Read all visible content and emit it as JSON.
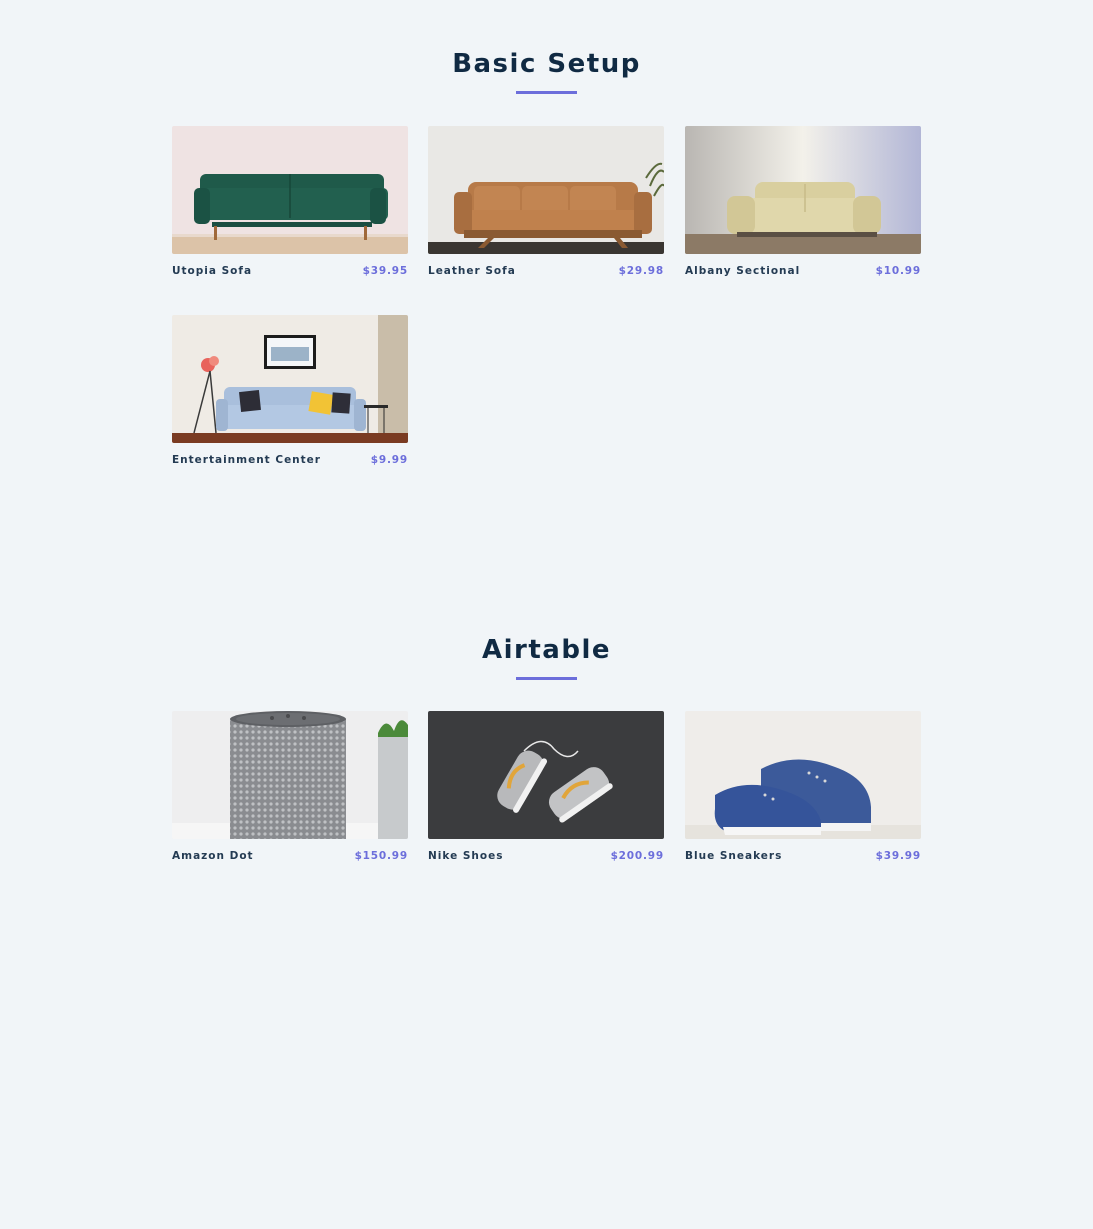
{
  "sections": [
    {
      "title": "Basic Setup",
      "products": [
        {
          "name": "Utopia Sofa",
          "price": "$39.95",
          "image": "green-sofa-image"
        },
        {
          "name": "Leather Sofa",
          "price": "$29.98",
          "image": "leather-sofa-image"
        },
        {
          "name": "Albany Sectional",
          "price": "$10.99",
          "image": "beige-sofa-image"
        },
        {
          "name": "Entertainment Center",
          "price": "$9.99",
          "image": "living-room-image"
        }
      ]
    },
    {
      "title": "Airtable",
      "products": [
        {
          "name": "Amazon Dot",
          "price": "$150.99",
          "image": "smart-speaker-image"
        },
        {
          "name": "Nike Shoes",
          "price": "$200.99",
          "image": "sneakers-image"
        },
        {
          "name": "Blue Sneakers",
          "price": "$39.99",
          "image": "blue-shoes-image"
        }
      ]
    }
  ],
  "colors": {
    "background": "#f1f5f8",
    "heading": "#102a43",
    "accent": "#6c6edb",
    "product_name": "#243b53"
  }
}
